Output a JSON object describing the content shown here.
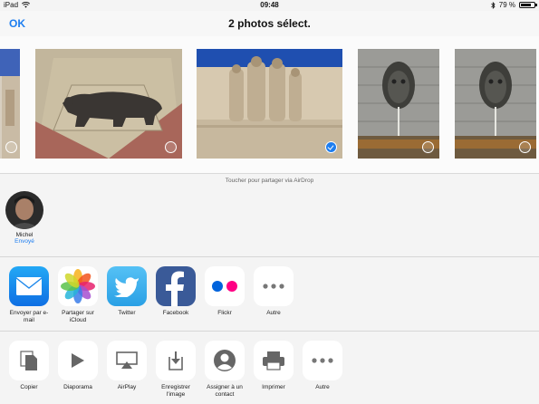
{
  "status_bar": {
    "device": "iPad",
    "time": "09:48",
    "battery": "79 %",
    "battery_level": 0.79
  },
  "nav": {
    "ok_label": "OK",
    "title": "2 photos sélect."
  },
  "photos": [
    {
      "subject": "stone facade (cropped)",
      "selected": false
    },
    {
      "subject": "bear mosaic on pavement",
      "selected": false
    },
    {
      "subject": "reformation wall statues",
      "selected": true
    },
    {
      "subject": "fountain mask",
      "selected": false
    },
    {
      "subject": "fountain mask",
      "selected": false
    }
  ],
  "airdrop": {
    "hint": "Toucher pour partager via AirDrop",
    "contact": {
      "name": "Michel",
      "status": "Envoyé"
    }
  },
  "share_row": [
    {
      "label": "Envoyer par e-mail",
      "icon": "mail-icon"
    },
    {
      "label": "Partager sur iCloud",
      "icon": "photos-icon"
    },
    {
      "label": "Twitter",
      "icon": "twitter-icon"
    },
    {
      "label": "Facebook",
      "icon": "facebook-icon"
    },
    {
      "label": "Flickr",
      "icon": "flickr-icon"
    },
    {
      "label": "Autre",
      "icon": "more-icon"
    }
  ],
  "action_row": [
    {
      "label": "Copier",
      "icon": "copy-icon"
    },
    {
      "label": "Diaporama",
      "icon": "play-icon"
    },
    {
      "label": "AirPlay",
      "icon": "airplay-icon"
    },
    {
      "label": "Enregistrer l'image",
      "icon": "save-image-icon"
    },
    {
      "label": "Assigner à un contact",
      "icon": "contact-icon"
    },
    {
      "label": "Imprimer",
      "icon": "printer-icon"
    },
    {
      "label": "Autre",
      "icon": "more-icon"
    }
  ],
  "colors": {
    "accent": "#1e7ef0",
    "flickr_blue": "#0063dc",
    "flickr_pink": "#ff0084"
  }
}
